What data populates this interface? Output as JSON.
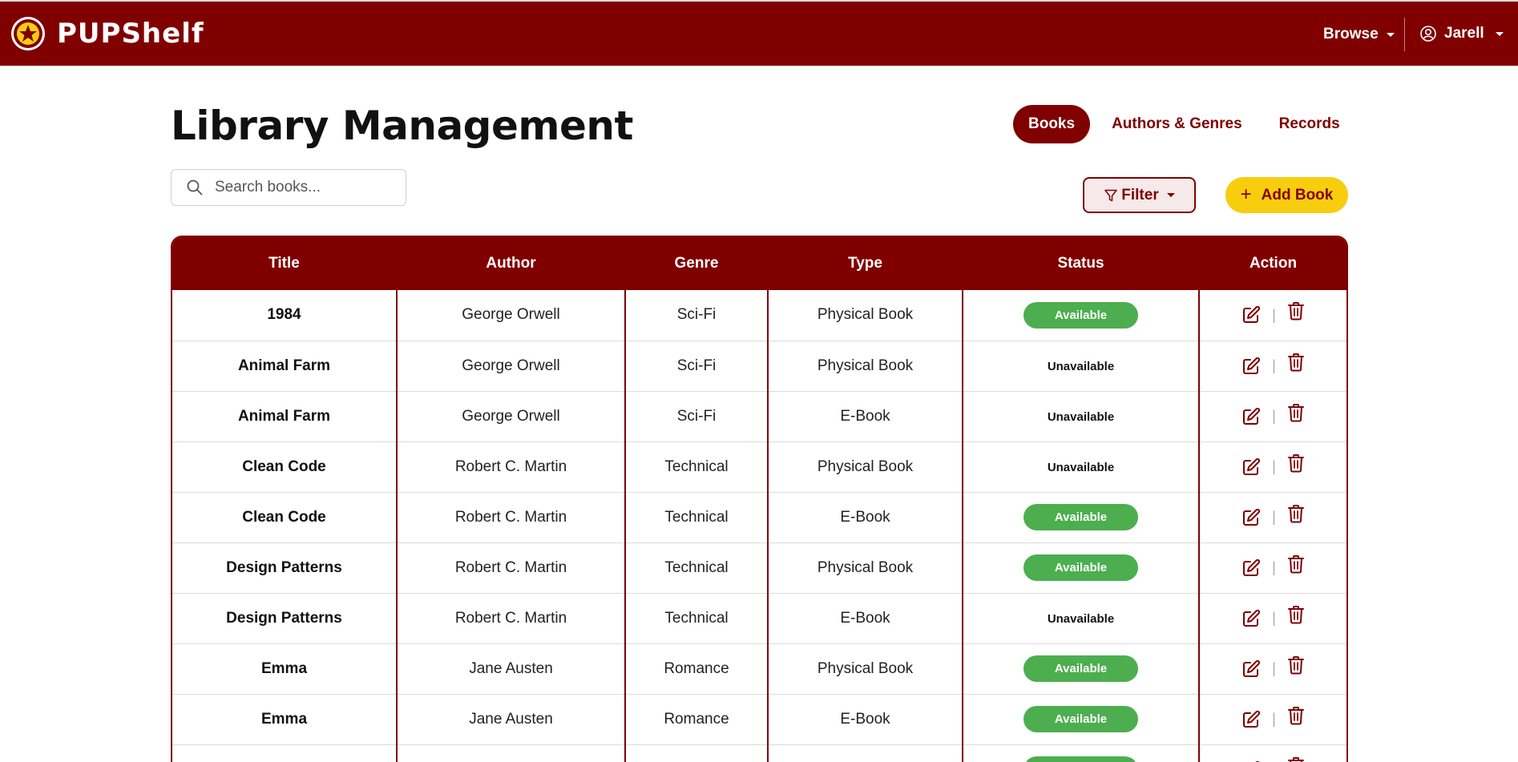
{
  "app": {
    "name": "PUPShelf"
  },
  "nav": {
    "browse": "Browse",
    "user": "Jarell"
  },
  "header": {
    "title": "Library Management"
  },
  "tabs": [
    {
      "label": "Books",
      "active": true
    },
    {
      "label": "Authors & Genres",
      "active": false
    },
    {
      "label": "Records",
      "active": false
    }
  ],
  "search": {
    "placeholder": "Search books..."
  },
  "toolbar": {
    "filter_label": "Filter",
    "add_label": "Add Book"
  },
  "table": {
    "columns": [
      "Title",
      "Author",
      "Genre",
      "Type",
      "Status",
      "Action"
    ],
    "rows": [
      {
        "title": "1984",
        "author": "George Orwell",
        "genre": "Sci-Fi",
        "type": "Physical Book",
        "status": "Available"
      },
      {
        "title": "Animal Farm",
        "author": "George Orwell",
        "genre": "Sci-Fi",
        "type": "Physical Book",
        "status": "Unavailable"
      },
      {
        "title": "Animal Farm",
        "author": "George Orwell",
        "genre": "Sci-Fi",
        "type": "E-Book",
        "status": "Unavailable"
      },
      {
        "title": "Clean Code",
        "author": "Robert C. Martin",
        "genre": "Technical",
        "type": "Physical Book",
        "status": "Unavailable"
      },
      {
        "title": "Clean Code",
        "author": "Robert C. Martin",
        "genre": "Technical",
        "type": "E-Book",
        "status": "Available"
      },
      {
        "title": "Design Patterns",
        "author": "Robert C. Martin",
        "genre": "Technical",
        "type": "Physical Book",
        "status": "Available"
      },
      {
        "title": "Design Patterns",
        "author": "Robert C. Martin",
        "genre": "Technical",
        "type": "E-Book",
        "status": "Unavailable"
      },
      {
        "title": "Emma",
        "author": "Jane Austen",
        "genre": "Romance",
        "type": "Physical Book",
        "status": "Available"
      },
      {
        "title": "Emma",
        "author": "Jane Austen",
        "genre": "Romance",
        "type": "E-Book",
        "status": "Available"
      },
      {
        "title": "",
        "author": "",
        "genre": "",
        "type": "",
        "status": "Available"
      }
    ]
  },
  "colors": {
    "primary": "#800000",
    "accent": "#f7cd0e",
    "available": "#4cae4f"
  },
  "icons": {
    "logo": "pup-seal-icon",
    "user": "user-circle-icon",
    "search": "search-icon",
    "filter": "filter-icon",
    "add": "plus-icon",
    "edit": "edit-icon",
    "delete": "trash-icon"
  }
}
